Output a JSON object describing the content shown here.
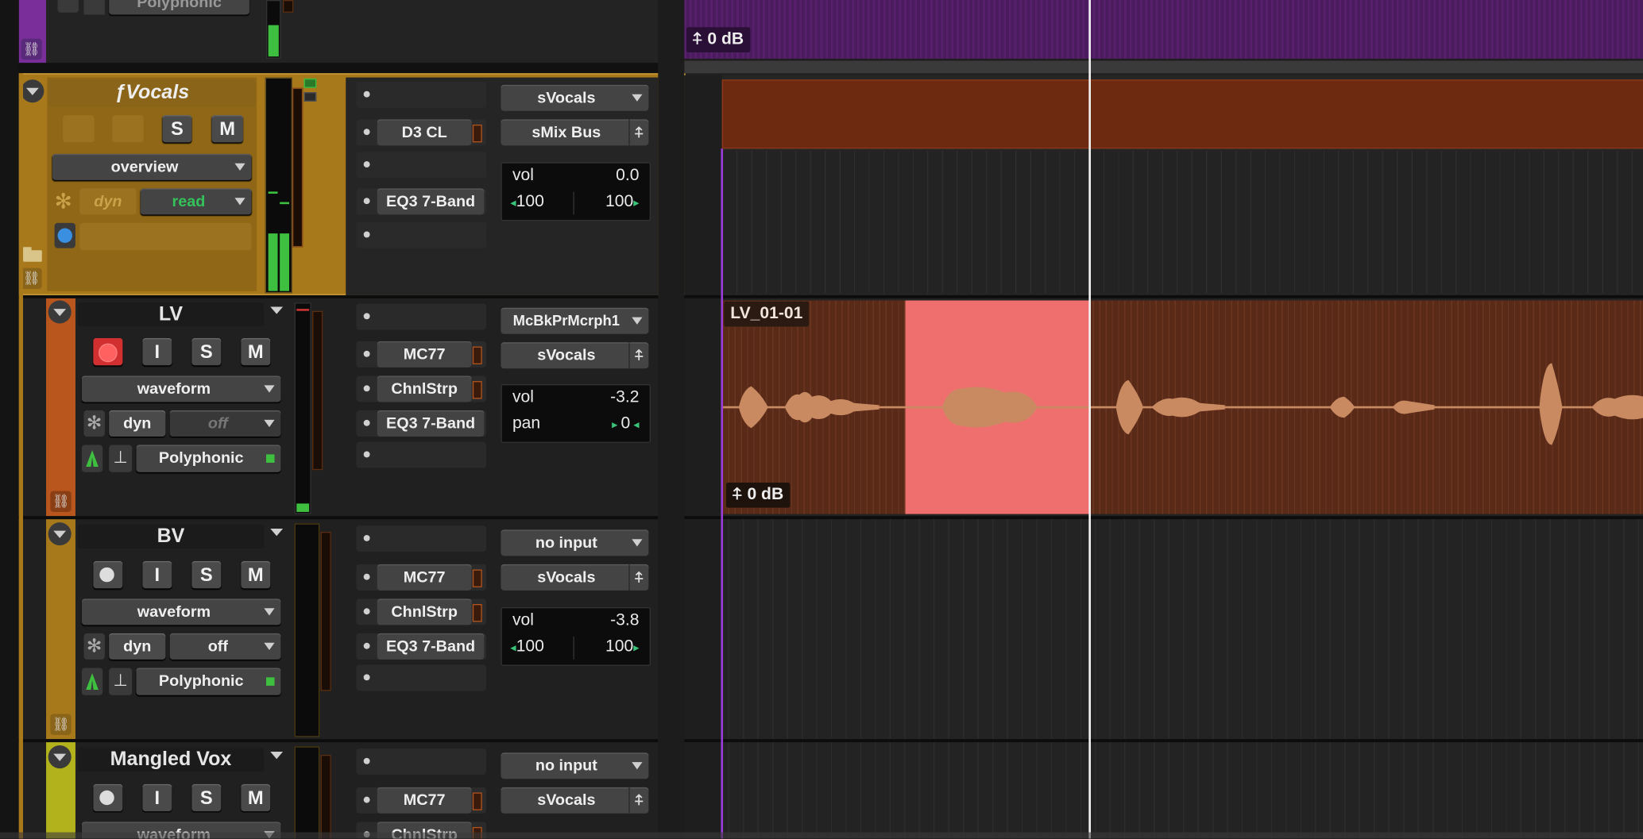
{
  "colors": {
    "track_top": "#7a2e9a",
    "fvocals": "#a8791a",
    "lv": "#b8561e",
    "bv": "#a8791a",
    "mangled": "#b2b21c",
    "clip_fill": "#6e2a10",
    "selection": "#ef6f6f",
    "waveform": "#c98a62",
    "playhead": "#ffffff",
    "timeline_start": "#9b3dd9"
  },
  "top_track": {
    "voice_label": "Polyphonic",
    "gain_label": "0 dB"
  },
  "tracks": [
    {
      "name": "ƒVocals",
      "view": "overview",
      "dyn_label": "dyn",
      "automation": "read",
      "solo": "S",
      "mute": "M",
      "inserts": [
        "",
        "D3 CL",
        "",
        "EQ3 7-Band",
        ""
      ],
      "input": "sVocals",
      "output": "sMix Bus",
      "vol_label": "vol",
      "vol": "0.0",
      "pan_left": "100",
      "pan_right": "100"
    },
    {
      "name": "LV",
      "view": "waveform",
      "dyn_label": "dyn",
      "automation": "off",
      "voice": "Polyphonic",
      "input_label": "I",
      "solo": "S",
      "mute": "M",
      "inserts": [
        "",
        "MC77",
        "ChnlStrp",
        "EQ3 7-Band",
        ""
      ],
      "input": "McBkPrMcrph1",
      "output": "sVocals",
      "vol_label": "vol",
      "vol": "-3.2",
      "pan_label": "pan",
      "pan": "0",
      "clip_name": "LV_01-01",
      "clip_gain": "0 dB"
    },
    {
      "name": "BV",
      "view": "waveform",
      "dyn_label": "dyn",
      "automation": "off",
      "voice": "Polyphonic",
      "input_label": "I",
      "solo": "S",
      "mute": "M",
      "inserts": [
        "",
        "MC77",
        "ChnlStrp",
        "EQ3 7-Band",
        ""
      ],
      "input": "no input",
      "output": "sVocals",
      "vol_label": "vol",
      "vol": "-3.8",
      "pan_left": "100",
      "pan_right": "100"
    },
    {
      "name": "Mangled Vox",
      "view": "waveform",
      "input_label": "I",
      "solo": "S",
      "mute": "M",
      "inserts": [
        "",
        "MC77",
        "ChnlStrp"
      ],
      "input": "no input",
      "output": "sVocals"
    }
  ],
  "icons": {
    "dyn": "asterisk-icon",
    "record": "record-icon",
    "pin": "insert-pin-icon",
    "tuning": "tuning-fork-icon",
    "metronome": "metronome-icon",
    "folder": "folder-icon",
    "link": "link-icon"
  }
}
